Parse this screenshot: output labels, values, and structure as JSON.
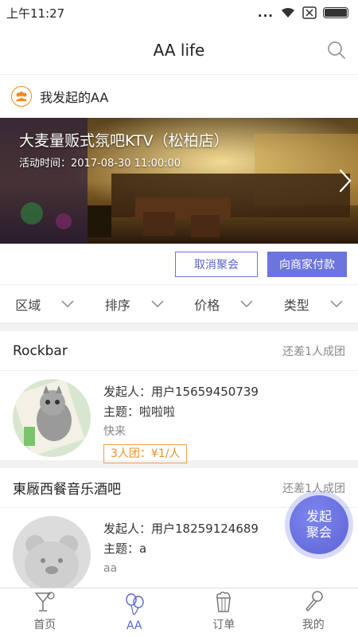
{
  "status_bar": {
    "time": "上午11:27",
    "dots": "...",
    "signal_icon": "wifi-icon",
    "sim_icon": "sim-off-icon",
    "battery_icon": "battery-icon"
  },
  "header": {
    "title": "AA life",
    "search_icon": "search-icon"
  },
  "section": {
    "title": "我发起的AA",
    "icon": "people-icon"
  },
  "banner": {
    "title": "大麦量贩式氛吧KTV（松柏店）",
    "time": "活动时间：2017-08-30 11:00:00"
  },
  "actions": {
    "cancel_label": "取消聚会",
    "pay_label": "向商家付款"
  },
  "filters": [
    {
      "label": "区域"
    },
    {
      "label": "排序"
    },
    {
      "label": "价格"
    },
    {
      "label": "类型"
    }
  ],
  "cards": [
    {
      "name": "Rockbar",
      "status": "还差1人成团",
      "initiator": "发起人：用户15659450739",
      "theme": "主题：啦啦啦",
      "note": "快来",
      "tag": "3人团：¥1/人"
    },
    {
      "name": "東厰西餐音乐酒吧",
      "status": "还差1人成团",
      "initiator": "发起人：用户18259124689",
      "theme": "主题：a",
      "note": "aa"
    }
  ],
  "float_button": {
    "line1": "发起",
    "line2": "聚会"
  },
  "tabs": [
    {
      "label": "首页",
      "icon": "cocktail-icon"
    },
    {
      "label": "AA",
      "icon": "balloon-icon"
    },
    {
      "label": "订单",
      "icon": "popcorn-icon"
    },
    {
      "label": "我的",
      "icon": "microphone-icon"
    }
  ],
  "colors": {
    "accent": "#6c74de",
    "tag_orange": "#ef8f2a",
    "icon_orange": "#f08a24"
  }
}
